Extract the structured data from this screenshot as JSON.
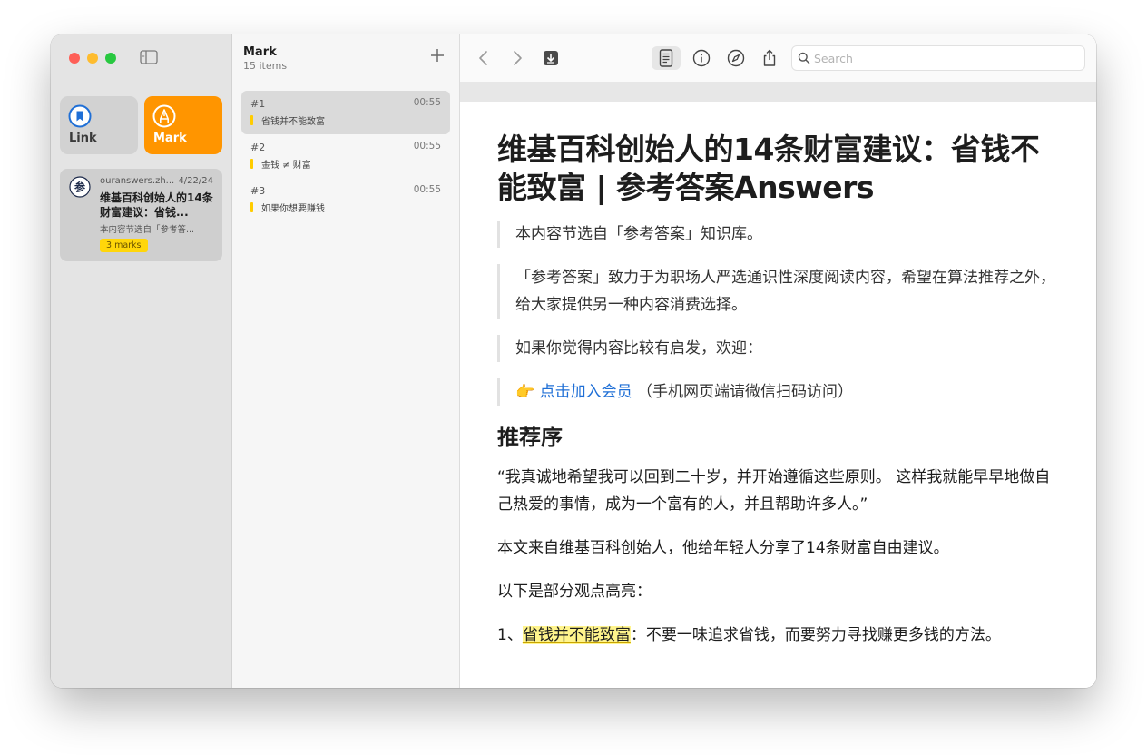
{
  "sidebar": {
    "categories": [
      {
        "label": "Link",
        "icon": "bookmark-icon",
        "color": "#1f6fd6"
      },
      {
        "label": "Mark",
        "icon": "pen-icon",
        "color": "#ff9500"
      }
    ],
    "card": {
      "favicon": "参",
      "domain": "ouranswers.zh...",
      "date": "4/22/24",
      "title": "维基百科创始人的14条财富建议：省钱...",
      "excerpt": "本内容节选自「参考答...",
      "badge": "3 marks"
    }
  },
  "list": {
    "title": "Mark",
    "count": "15 items",
    "items": [
      {
        "num": "#1",
        "time": "00:55",
        "text": "省钱并不能致富"
      },
      {
        "num": "#2",
        "time": "00:55",
        "text": "金钱 ≠ 财富"
      },
      {
        "num": "#3",
        "time": "00:55",
        "text": "如果你想要赚钱"
      }
    ]
  },
  "toolbar": {
    "search_placeholder": "Search"
  },
  "article": {
    "title": "维基百科创始人的14条财富建议：省钱不能致富 | 参考答案Answers",
    "quote1": "本内容节选自「参考答案」知识库。",
    "quote2": "「参考答案」致力于为职场人严选通识性深度阅读内容，希望在算法推荐之外，给大家提供另一种内容消费选择。",
    "quote3": "如果你觉得内容比较有启发，欢迎：",
    "quote4_emoji": "👉",
    "quote4_link": "点击加入会员",
    "quote4_rest": "（手机网页端请微信扫码访问）",
    "h2": "推荐序",
    "p1": "“我真诚地希望我可以回到二十岁，并开始遵循这些原则。 这样我就能早早地做自己热爱的事情，成为一个富有的人，并且帮助许多人。”",
    "p2": "本文来自维基百科创始人，他给年轻人分享了14条财富自由建议。",
    "p3": "以下是部分观点高亮：",
    "p4_prefix": "1、",
    "p4_highlight": "省钱并不能致富",
    "p4_rest": "：不要一味追求省钱，而要努力寻找赚更多钱的方法。"
  }
}
